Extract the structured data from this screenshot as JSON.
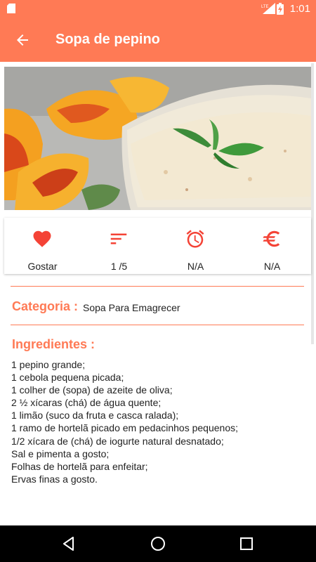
{
  "status_bar": {
    "time": "1:01",
    "network": "LTE",
    "icons": [
      "sd-card-icon",
      "signal-icon",
      "battery-charging-icon"
    ]
  },
  "app_bar": {
    "title": "Sopa de pepino",
    "back_icon": "arrow-back-icon"
  },
  "stats": [
    {
      "icon": "heart-icon",
      "label": "Gostar"
    },
    {
      "icon": "sort-rating-icon",
      "label": "1 /5"
    },
    {
      "icon": "alarm-clock-icon",
      "label": "N/A"
    },
    {
      "icon": "euro-icon",
      "label": "N/A"
    }
  ],
  "category": {
    "label": "Categoria :",
    "value": "Sopa Para Emagrecer"
  },
  "ingredients": {
    "label": "Ingredientes :",
    "items": [
      "1 pepino grande;",
      "1 cebola pequena picada;",
      "1 colher de (sopa) de azeite de oliva;",
      "2 ½ xícaras (chá) de água quente;",
      "1 limão (suco da fruta e casca ralada);",
      "1 ramo de hortelã picado em pedacinhos pequenos;",
      "1/2 xícara de (chá) de iogurte natural desnatado;",
      "Sal e pimenta a gosto;",
      "Folhas de hortelã para enfeitar;",
      "Ervas finas a gosto."
    ]
  },
  "colors": {
    "accent": "#ff7a55",
    "icon_red": "#f44336",
    "nav_bar": "#000000"
  },
  "nav_bar": {
    "icons": [
      "back-triangle-icon",
      "home-circle-icon",
      "recents-square-icon"
    ]
  }
}
